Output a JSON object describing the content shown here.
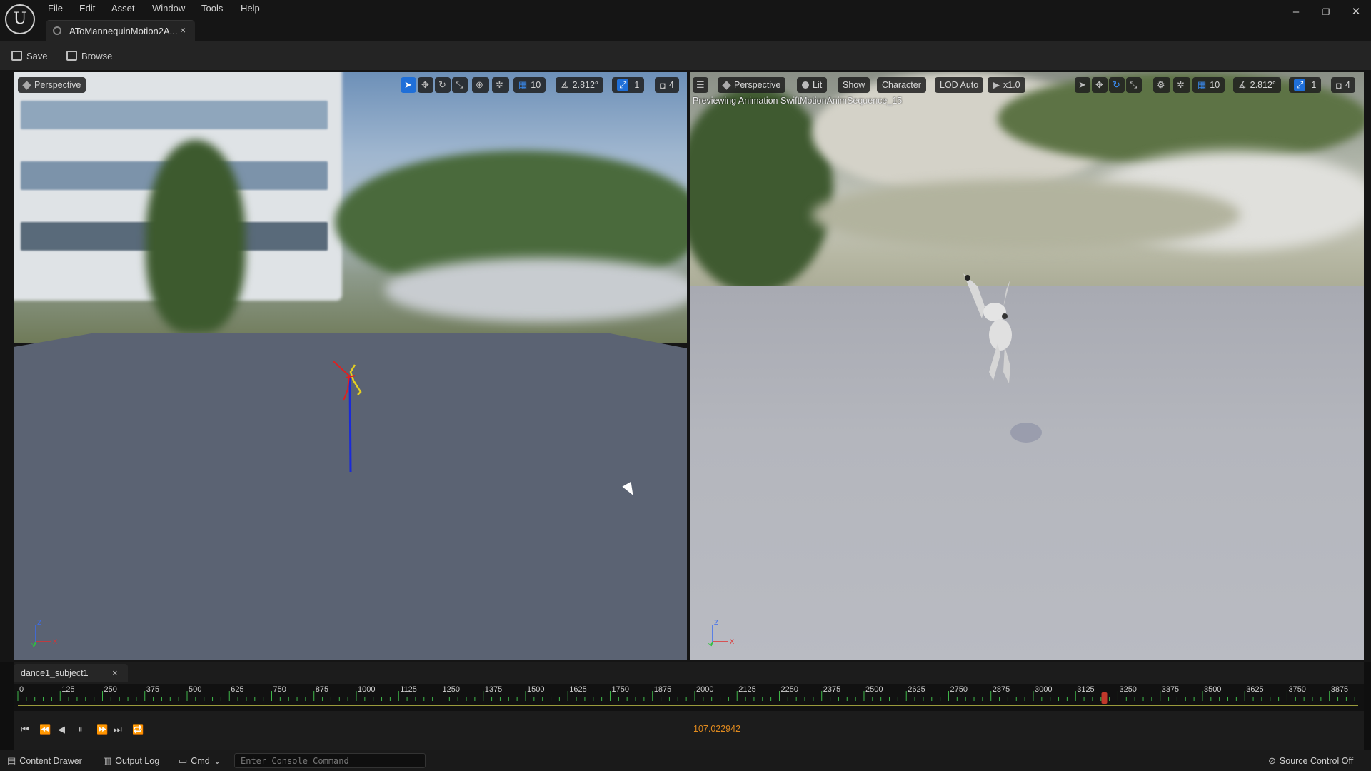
{
  "app": {
    "logo_text": "U"
  },
  "menu": [
    "File",
    "Edit",
    "Asset",
    "Window",
    "Tools",
    "Help"
  ],
  "document_tab": {
    "label": "AToMannequinMotion2A...",
    "close": "×"
  },
  "window_controls": {
    "minimize": "–",
    "restore": "❐",
    "close": "✕"
  },
  "toolbar": {
    "save_label": "Save",
    "browse_label": "Browse"
  },
  "left_viewport": {
    "perspective_label": "Perspective",
    "grid_value": "10",
    "angle_value": "2.812°",
    "scale_value": "1",
    "camera_speed": "4"
  },
  "right_viewport": {
    "perspective_label": "Perspective",
    "lit_label": "Lit",
    "show_label": "Show",
    "character_label": "Character",
    "lod_label": "LOD Auto",
    "play_rate": "x1.0",
    "grid_value": "10",
    "angle_value": "2.812°",
    "scale_value": "1",
    "camera_speed": "4",
    "preview_text": "Previewing Animation SwiftMotionAnimSequence_15"
  },
  "timeline": {
    "tab_label": "dance1_subject1",
    "tab_close": "×",
    "ticks": [
      "0",
      "125",
      "250",
      "375",
      "500",
      "625",
      "750",
      "875",
      "1000",
      "1125",
      "1250",
      "1375",
      "1500",
      "1625",
      "1750",
      "1875",
      "2000",
      "2125",
      "2250",
      "2375",
      "2500",
      "2625",
      "2750",
      "2875",
      "3000",
      "3125",
      "3250",
      "3375",
      "3500",
      "3625",
      "3750",
      "3875"
    ],
    "playhead_frame": 3210,
    "max_frame": 3960,
    "time_readout": "107.022942"
  },
  "statusbar": {
    "content_drawer": "Content Drawer",
    "output_log": "Output Log",
    "cmd_label": "Cmd",
    "console_placeholder": "Enter Console Command",
    "source_control": "Source Control Off"
  },
  "colors": {
    "accent": "#1f6fd8",
    "time_readout": "#e08a1e",
    "playhead": "#c0392b"
  }
}
